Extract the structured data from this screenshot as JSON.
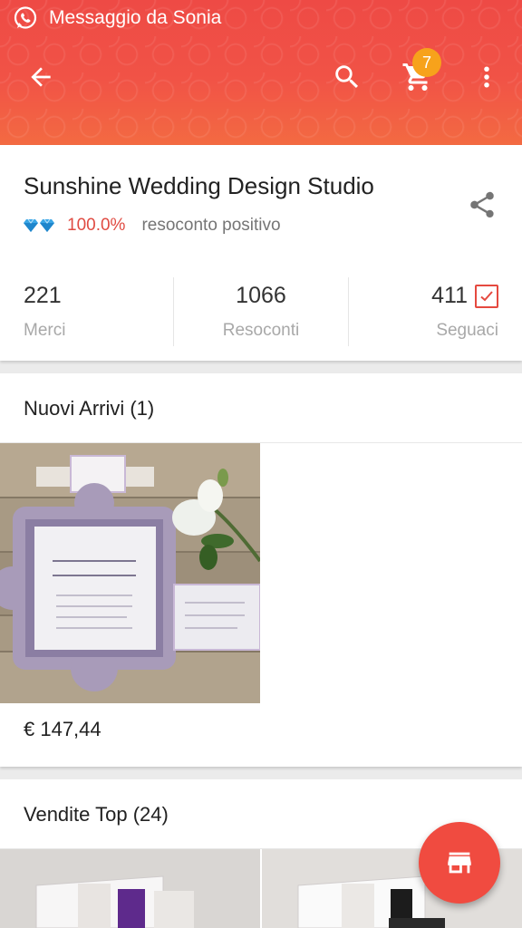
{
  "notification": {
    "text": "Messaggio da Sonia",
    "app_icon": "whatsapp-icon"
  },
  "toolbar": {
    "back_icon": "arrow-back-icon",
    "search_icon": "search-icon",
    "cart_icon": "cart-icon",
    "cart_count": "7",
    "more_icon": "more-vert-icon"
  },
  "store": {
    "name": "Sunshine Wedding Design Studio",
    "rating_value": "100.0%",
    "rating_text": "resoconto positivo",
    "share_icon": "share-icon",
    "stats": [
      {
        "value": "221",
        "label": "Merci"
      },
      {
        "value": "1066",
        "label": "Resoconti"
      },
      {
        "value": "411",
        "label": "Seguaci"
      }
    ]
  },
  "new_arrivals": {
    "title": "Nuovi Arrivi (1)",
    "products": [
      {
        "price": "€ 147,44"
      }
    ]
  },
  "top_sales": {
    "title": "Vendite Top (24)"
  },
  "fab": {
    "icon": "store-icon"
  },
  "colors": {
    "accent": "#f04b40",
    "badge": "#f7a21b",
    "header_top": "#ee4a45"
  }
}
